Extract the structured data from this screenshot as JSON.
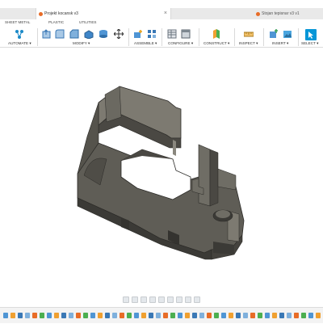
{
  "tabs": [
    {
      "label": "Projekt kocansk v3",
      "active": true
    },
    {
      "label": "Stojan tepisnar v3 v1",
      "active": false
    }
  ],
  "subtabs": [
    "SHEET METAL",
    "PLASTIC",
    "UTILITIES"
  ],
  "toolbar": {
    "groups": [
      {
        "label": "AUTOMATE ▾"
      },
      {
        "label": "MODIFY ▾"
      },
      {
        "label": "ASSEMBLE ▾"
      },
      {
        "label": "CONFIGURE ▾"
      },
      {
        "label": "CONSTRUCT ▾"
      },
      {
        "label": "INSPECT ▾"
      },
      {
        "label": "INSERT ▾"
      },
      {
        "label": "SELECT ▾"
      }
    ]
  },
  "colors": {
    "accent": "#0696d7",
    "model_dark": "#3b3a36",
    "model_mid": "#5f5d56",
    "model_light": "#7d7a71",
    "tab_icon": "#e86c27"
  },
  "nav_icons": [
    "orbit-icon",
    "pan-icon",
    "zoom-icon",
    "fit-icon",
    "display-icon",
    "grid-icon",
    "viewports-icon"
  ],
  "timeline": {
    "item_count": 44
  }
}
